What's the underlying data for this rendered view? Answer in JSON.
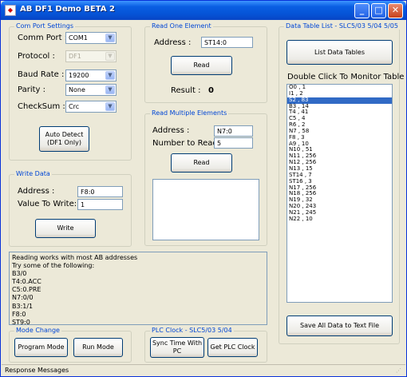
{
  "window": {
    "title": "AB DF1 Demo BETA 2",
    "minimize": "_",
    "maximize": "□",
    "close": "✕"
  },
  "com_port_settings": {
    "title": "Com Port Settings",
    "comm_port_label": "Comm Port :",
    "comm_port_value": "COM1",
    "protocol_label": "Protocol :",
    "protocol_value": "DF1",
    "baud_label": "Baud Rate :",
    "baud_value": "19200",
    "parity_label": "Parity :",
    "parity_value": "None",
    "checksum_label": "CheckSum :",
    "checksum_value": "Crc",
    "auto_detect_line1": "Auto Detect",
    "auto_detect_line2": "(DF1 Only)"
  },
  "write_data": {
    "title": "Write Data",
    "address_label": "Address :",
    "address_value": "F8:0",
    "value_label": "Value To Write:",
    "value_value": "1",
    "write_button": "Write"
  },
  "read_one": {
    "title": "Read One Element",
    "address_label": "Address :",
    "address_value": "ST14:0",
    "read_button": "Read",
    "result_label": "Result :",
    "result_value": "0"
  },
  "read_multiple": {
    "title": "Read Multiple Elements",
    "address_label": "Address :",
    "address_value": "N7:0",
    "number_label": "Number to Read :",
    "number_value": "5",
    "read_button": "Read"
  },
  "data_table": {
    "title": "Data Table List - SLC5/03 5/04 5/05",
    "list_button": "List Data Tables",
    "monitor_label": "Double Click To Monitor Table",
    "items": [
      "O0 , 1",
      "I1 , 2",
      "S2 , 83",
      "B3 , 14",
      "T4 , 41",
      "C5 , 4",
      "R6 , 2",
      "N7 , 58",
      "F8 , 3",
      "A9 , 10",
      "N10 , 51",
      "N11 , 256",
      "N12 , 256",
      "N13 , 15",
      "ST14 , 7",
      "ST16 , 3",
      "N17 , 256",
      "N18 , 256",
      "N19 , 32",
      "N20 , 243",
      "N21 , 245",
      "N22 , 10"
    ],
    "selected_index": 2,
    "save_button": "Save All Data to Text File"
  },
  "messages": {
    "lines": [
      "Reading works with most AB addresses",
      "Try some of the following:",
      "B3/0",
      "T4:0.ACC",
      "C5:0.PRE",
      "N7:0/0",
      "B3:1/1",
      "F8:0",
      "ST9:0"
    ]
  },
  "mode_change": {
    "title": "Mode Change",
    "program_button": "Program Mode",
    "run_button": "Run Mode"
  },
  "plc_clock": {
    "title": "PLC Clock - SLC5/03 5/04",
    "sync_line1": "Sync Time With",
    "sync_line2": "PC",
    "get_button": "Get PLC Clock"
  },
  "statusbar": {
    "text": "Response Messages"
  }
}
